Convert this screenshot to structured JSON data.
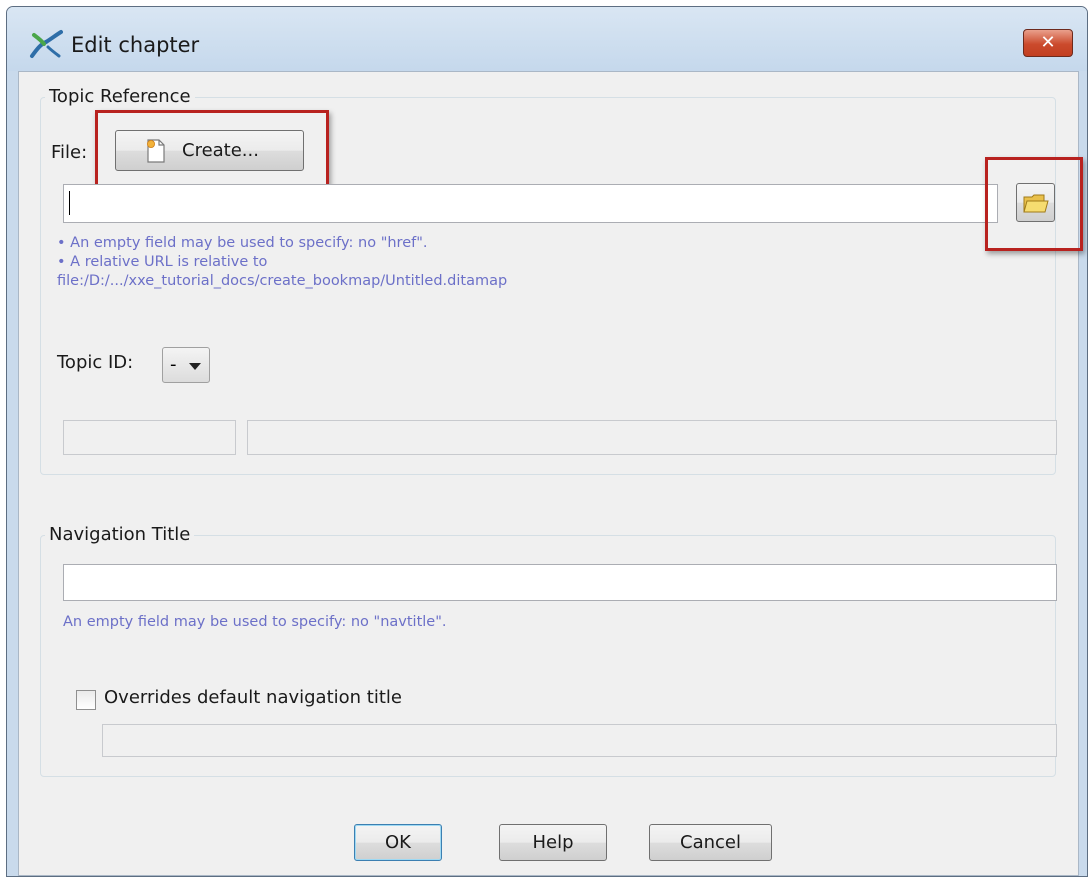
{
  "window": {
    "title": "Edit chapter",
    "close_glyph": "✕"
  },
  "topic_reference": {
    "legend": "Topic Reference",
    "file_label": "File:",
    "create_button": "Create...",
    "file_value": "",
    "browse_icon": "folder-icon",
    "hint_lines": [
      "• An empty field may be used to specify: no \"href\".",
      "• A relative URL is relative to",
      "file:/D:/.../xxe_tutorial_docs/create_bookmap/Untitled.ditamap"
    ],
    "topic_id_label": "Topic ID:",
    "topic_id_value": "-",
    "id_field_left": "",
    "id_field_right": ""
  },
  "navigation_title": {
    "legend": "Navigation Title",
    "value": "",
    "hint": "An empty field may be used to specify: no \"navtitle\".",
    "override_label": "Overrides default navigation title",
    "override_checked": false,
    "override_value": ""
  },
  "buttons": {
    "ok": "OK",
    "help": "Help",
    "cancel": "Cancel"
  },
  "colors": {
    "hint_text": "#6c70c8",
    "highlight_box": "#b8221f"
  }
}
